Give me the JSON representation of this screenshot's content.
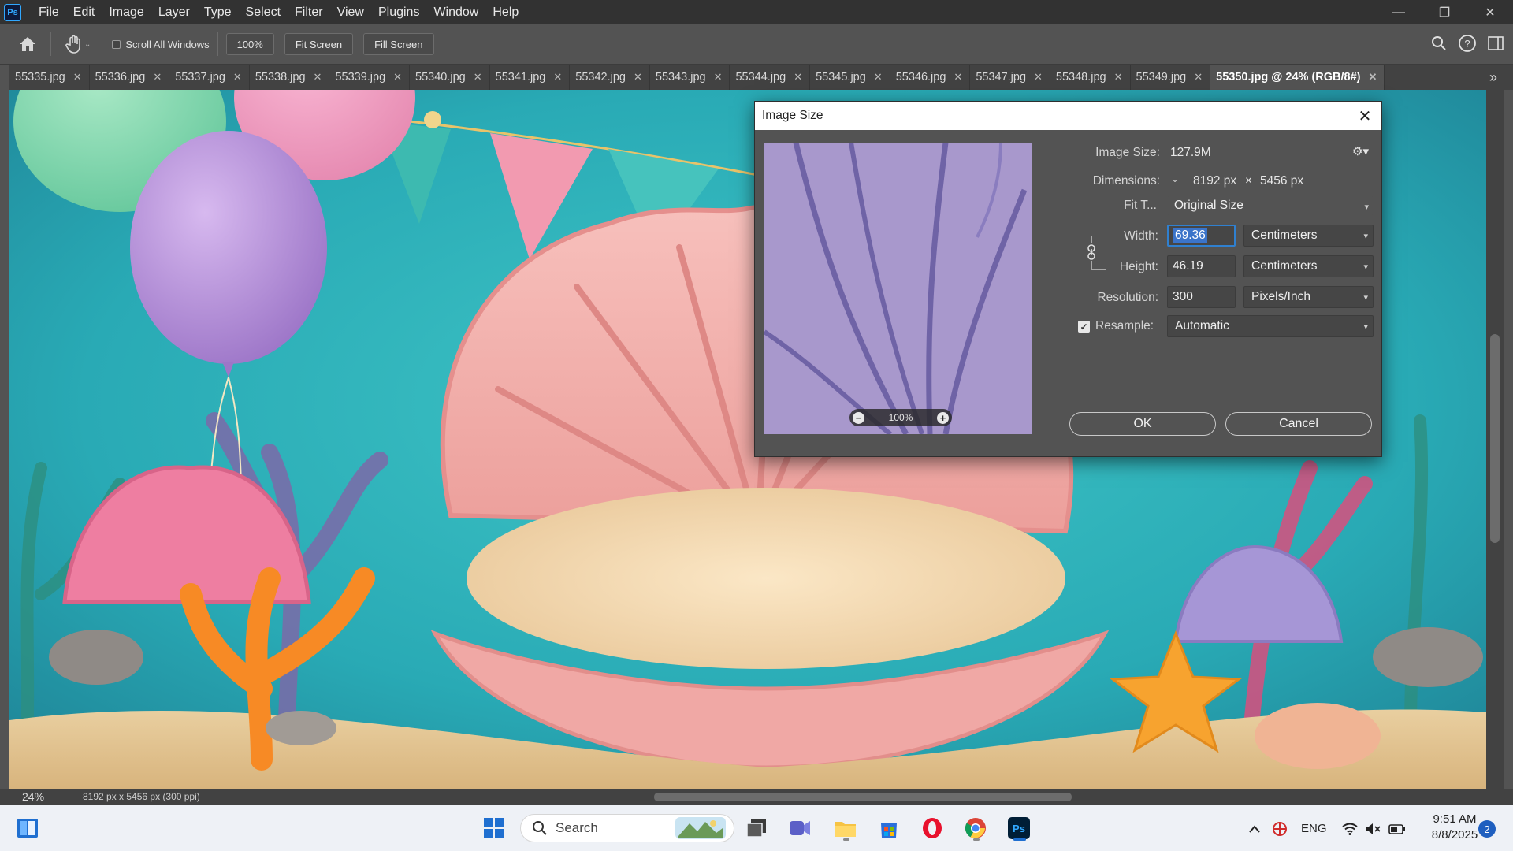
{
  "app": {
    "logo": "Ps"
  },
  "menu": [
    "File",
    "Edit",
    "Image",
    "Layer",
    "Type",
    "Select",
    "Filter",
    "View",
    "Plugins",
    "Window",
    "Help"
  ],
  "window_controls": {
    "minimize": "—",
    "restore": "❐",
    "close": "✕"
  },
  "options_bar": {
    "scroll_all_label": "Scroll All Windows",
    "zoom_button": "100%",
    "fit_screen_button": "Fit Screen",
    "fill_screen_button": "Fill Screen"
  },
  "tabs": [
    {
      "label": "55335.jpg"
    },
    {
      "label": "55336.jpg"
    },
    {
      "label": "55337.jpg"
    },
    {
      "label": "55338.jpg"
    },
    {
      "label": "55339.jpg"
    },
    {
      "label": "55340.jpg"
    },
    {
      "label": "55341.jpg"
    },
    {
      "label": "55342.jpg"
    },
    {
      "label": "55343.jpg"
    },
    {
      "label": "55344.jpg"
    },
    {
      "label": "55345.jpg"
    },
    {
      "label": "55346.jpg"
    },
    {
      "label": "55347.jpg"
    },
    {
      "label": "55348.jpg"
    },
    {
      "label": "55349.jpg"
    },
    {
      "label": "55350.jpg @ 24% (RGB/8#)",
      "active": true
    }
  ],
  "tab_close_glyph": "✕",
  "status": {
    "zoom": "24%",
    "doc_info": "8192 px x 5456 px (300 ppi)"
  },
  "dialog": {
    "title": "Image Size",
    "close_glyph": "✕",
    "preview_zoom": "100%",
    "image_size_label": "Image Size:",
    "image_size_value": "127.9M",
    "dimensions_label": "Dimensions:",
    "dimensions_width": "8192 px",
    "dimensions_times": "×",
    "dimensions_height": "5456 px",
    "fit_to_label": "Fit T...",
    "fit_to_value": "Original Size",
    "width_label": "Width:",
    "width_value": "69.36",
    "width_unit": "Centimeters",
    "height_label": "Height:",
    "height_value": "46.19",
    "height_unit": "Centimeters",
    "resolution_label": "Resolution:",
    "resolution_value": "300",
    "resolution_unit": "Pixels/Inch",
    "resample_label": "Resample:",
    "resample_checked": true,
    "resample_value": "Automatic",
    "ok_button": "OK",
    "cancel_button": "Cancel"
  },
  "taskbar": {
    "search_label": "Search",
    "language": "ENG",
    "time": "9:51 AM",
    "date": "8/8/2025",
    "notification_count": "2"
  },
  "colors": {
    "ps_accent": "#31a8ff",
    "menubar_bg": "#323232",
    "panel_bg": "#535353",
    "focus_blue": "#2f80d0",
    "taskbar_bg": "#eef1f6"
  }
}
